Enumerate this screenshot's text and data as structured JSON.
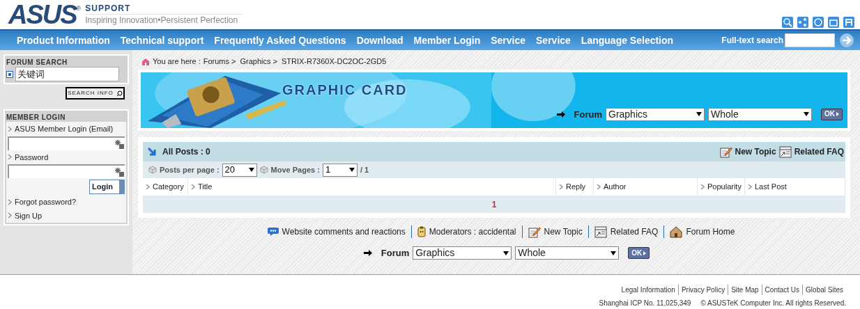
{
  "header": {
    "logo": "ASUS",
    "logo_mark": "®",
    "brand": "SUPPORT",
    "tagline": "Inspiring Innovation•Persistent Perfection"
  },
  "nav": {
    "items": [
      "Product Information",
      "Technical support",
      "Frequently Asked Questions",
      "Download",
      "Member Login",
      "Service",
      "Service",
      "Language Selection"
    ],
    "search_label": "Full-text search"
  },
  "sidebar": {
    "forum_search": {
      "title": "FORUM SEARCH",
      "keyword": "关键词",
      "button": "SEARCH INFO"
    },
    "member_login": {
      "title": "MEMBER LOGIN",
      "email_label": "ASUS Member Login (Email)",
      "password_label": "Password",
      "login_button": "Login",
      "links": [
        "Forgot password?",
        "Sign Up"
      ]
    }
  },
  "breadcrumb": {
    "prefix": "You are here : ",
    "items": [
      "Forums >",
      "Graphics >",
      "STRIX-R7360X-DC2OC-2GD5"
    ]
  },
  "banner": {
    "title": "GRAPHIC CARD",
    "filter": {
      "label": "Forum",
      "forum": "Graphics",
      "scope": "Whole",
      "ok": "OK"
    }
  },
  "posts": {
    "title": "All Posts : 0",
    "actions": [
      {
        "kind": "new",
        "label": "New Topic"
      },
      {
        "kind": "faq",
        "label": "Related FAQ"
      }
    ],
    "per_page_label": "Posts per page :",
    "per_page": "20",
    "move_label": "Move Pages :",
    "page": "1",
    "page_total": "/ 1",
    "columns": [
      "Category",
      "Title",
      "Reply",
      "Author",
      "Popularity",
      "Last Post"
    ],
    "pager": "1"
  },
  "bottom_links": [
    {
      "kind": "comment",
      "label": "Website comments and reactions"
    },
    {
      "kind": "moderator",
      "label": "Moderators : accidental"
    },
    {
      "kind": "new",
      "label": "New Topic"
    },
    {
      "kind": "faq",
      "label": "Related FAQ"
    },
    {
      "kind": "home",
      "label": "Forum Home"
    }
  ],
  "bottom_filter": {
    "label": "Forum",
    "forum": "Graphics",
    "scope": "Whole",
    "ok": "OK"
  },
  "footer": {
    "links": [
      "Legal Information",
      "Privacy Policy",
      "Site Map",
      "Contact Us",
      "Global Sites"
    ],
    "icp": "Shanghai ICP No. 11,025,349",
    "copyright": "© ASUSTeK Computer Inc. All rights Reserved."
  }
}
